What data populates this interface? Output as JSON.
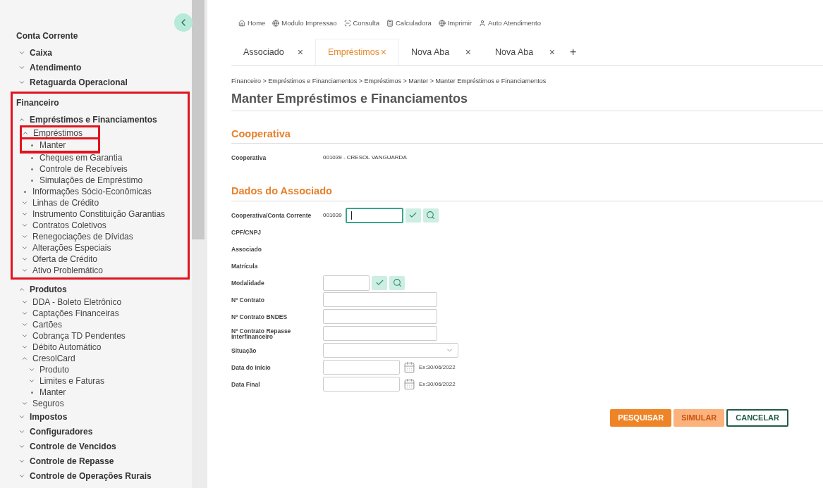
{
  "sidebar": {
    "sections": [
      {
        "heading": "Conta Corrente",
        "items": [
          {
            "label": "Caixa",
            "kind": "group",
            "expanded": false
          },
          {
            "label": "Atendimento",
            "kind": "group",
            "expanded": false
          },
          {
            "label": "Retaguarda Operacional",
            "kind": "group",
            "expanded": false
          }
        ]
      },
      {
        "heading": "Financeiro",
        "highlighted": true,
        "items": [
          {
            "label": "Empréstimos e Financiamentos",
            "kind": "group",
            "expanded": true,
            "children": [
              {
                "label": "Empréstimos",
                "kind": "group",
                "expanded": true,
                "highlighted": true,
                "children": [
                  {
                    "label": "Manter",
                    "kind": "leaf",
                    "highlighted": true
                  },
                  {
                    "label": "Cheques em Garantia",
                    "kind": "leaf"
                  },
                  {
                    "label": "Controle de Recebíveis",
                    "kind": "leaf"
                  },
                  {
                    "label": "Simulações de Empréstimo",
                    "kind": "leaf"
                  }
                ]
              },
              {
                "label": "Informações Sócio-Econômicas",
                "kind": "leaf"
              },
              {
                "label": "Linhas de Crédito",
                "kind": "group",
                "expanded": false
              },
              {
                "label": "Instrumento Constituição Garantias",
                "kind": "group",
                "expanded": false
              },
              {
                "label": "Contratos Coletivos",
                "kind": "group",
                "expanded": false
              },
              {
                "label": "Renegociações de Dívidas",
                "kind": "group",
                "expanded": false
              },
              {
                "label": "Alterações Especiais",
                "kind": "group",
                "expanded": false
              },
              {
                "label": "Oferta de Crédito",
                "kind": "group",
                "expanded": false
              },
              {
                "label": "Ativo Problemático",
                "kind": "group",
                "expanded": false
              }
            ]
          }
        ]
      },
      {
        "items": [
          {
            "label": "Produtos",
            "kind": "group",
            "expanded": true,
            "children": [
              {
                "label": "DDA - Boleto Eletrônico",
                "kind": "group",
                "expanded": false
              },
              {
                "label": "Captações Financeiras",
                "kind": "group",
                "expanded": false
              },
              {
                "label": "Cartões",
                "kind": "group",
                "expanded": false
              },
              {
                "label": "Cobrança TD Pendentes",
                "kind": "group",
                "expanded": false
              },
              {
                "label": "Débito Automático",
                "kind": "group",
                "expanded": false
              },
              {
                "label": "CresolCard",
                "kind": "group",
                "expanded": true,
                "children": [
                  {
                    "label": "Produto",
                    "kind": "group",
                    "expanded": false
                  },
                  {
                    "label": "Limites e Faturas",
                    "kind": "group",
                    "expanded": false
                  },
                  {
                    "label": "Manter",
                    "kind": "leaf"
                  }
                ]
              },
              {
                "label": "Seguros",
                "kind": "group",
                "expanded": false
              }
            ]
          },
          {
            "label": "Impostos",
            "kind": "group",
            "expanded": false
          },
          {
            "label": "Configuradores",
            "kind": "group",
            "expanded": false
          },
          {
            "label": "Controle de Vencidos",
            "kind": "group",
            "expanded": false
          },
          {
            "label": "Controle de Repasse",
            "kind": "group",
            "expanded": false
          },
          {
            "label": "Controle de Operações Rurais",
            "kind": "group",
            "expanded": false
          }
        ]
      }
    ]
  },
  "toolbar": [
    {
      "label": "Home"
    },
    {
      "label": "Modulo Impressao"
    },
    {
      "label": "Consulta"
    },
    {
      "label": "Calculadora"
    },
    {
      "label": "Imprimir"
    },
    {
      "label": "Auto Atendimento"
    }
  ],
  "tabs": [
    {
      "label": "Associado",
      "selected": false
    },
    {
      "label": "Empréstimos",
      "selected": true
    },
    {
      "label": "Nova Aba",
      "selected": false
    },
    {
      "label": "Nova Aba",
      "selected": false
    }
  ],
  "tab_close": "×",
  "tab_add": "+",
  "breadcrumb": "Financeiro > Empréstimos e Financiamentos > Empréstimos > Manter > Manter Empréstimos e Financiamentos",
  "page_title": "Manter Empréstimos e Financiamentos",
  "sections": [
    {
      "title": "Cooperativa",
      "fields": [
        {
          "label": "Cooperativa",
          "kind": "text",
          "value": "001039 - CRESOL VANGUARDA"
        }
      ]
    },
    {
      "title": "Dados do Associado",
      "fields": [
        {
          "label": "Cooperativa/Conta Corrente",
          "kind": "lookup",
          "prefix": "001039",
          "focused": true
        },
        {
          "label": "CPF/CNPJ",
          "kind": "text"
        },
        {
          "label": "Associado",
          "kind": "text"
        },
        {
          "label": "Matrícula",
          "kind": "text"
        },
        {
          "label": "Modalidade",
          "kind": "lookup",
          "focused": false
        },
        {
          "label": "Nº Contrato",
          "kind": "input"
        },
        {
          "label": "Nº Contrato BNDES",
          "kind": "input"
        },
        {
          "label": "Nº Contrato Repasse Interfinanceiro",
          "kind": "input"
        },
        {
          "label": "Situação",
          "kind": "select"
        },
        {
          "label": "Data do Início",
          "kind": "date",
          "hint": "Ex:30/06/2022"
        },
        {
          "label": "Data Final",
          "kind": "date",
          "hint": "Ex:30/06/2022"
        }
      ]
    }
  ],
  "buttons": [
    {
      "label": "PESQUISAR",
      "kind": "primary",
      "disabled": false
    },
    {
      "label": "SIMULAR",
      "kind": "primary",
      "disabled": true
    },
    {
      "label": "CANCELAR",
      "kind": "outline"
    }
  ]
}
